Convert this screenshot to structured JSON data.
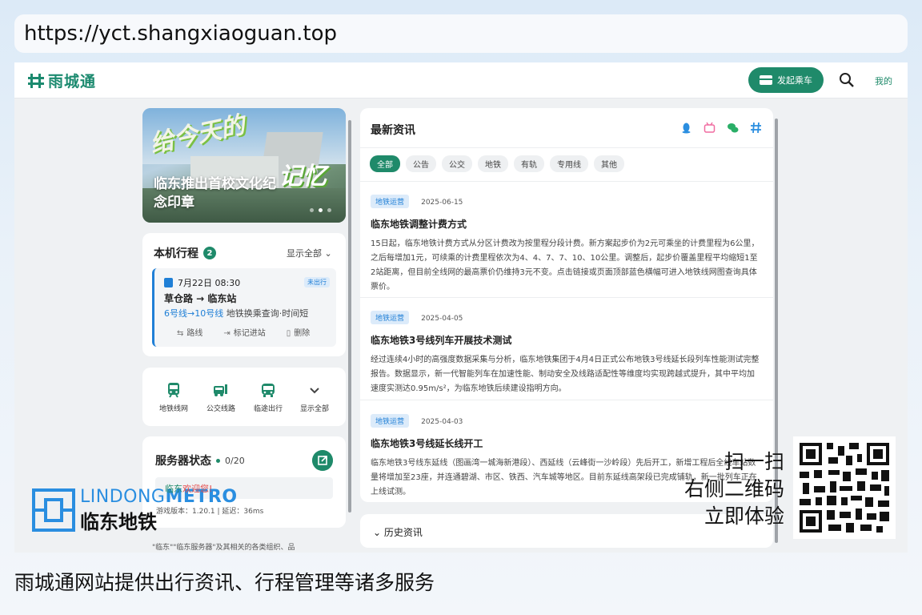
{
  "url": "https://yct.shangxiaoguan.top",
  "nav": {
    "brand": "雨城通",
    "ride_label": "发起乘车",
    "mine_label": "我的"
  },
  "banner": {
    "title": "临东推出首校文化纪念印章",
    "art_line1": "给今天的",
    "art_line2": "记忆"
  },
  "trips": {
    "title": "本机行程",
    "count": "2",
    "show_all": "显示全部 ⌄",
    "item": {
      "date": "7月22日 08:30",
      "status": "未出行",
      "route": "草仓路 → 临东站",
      "lines": "6号线→10号线",
      "desc": "地铁换乘查询·时间短",
      "actions": [
        "路线",
        "标记进站",
        "删除"
      ]
    }
  },
  "quick": [
    {
      "label": "地铁线网",
      "icon": "subway-icon"
    },
    {
      "label": "公交线路",
      "icon": "bus-icon"
    },
    {
      "label": "临途出行",
      "icon": "coach-icon"
    },
    {
      "label": "显示全部",
      "icon": "chevron-down-icon"
    }
  ],
  "server": {
    "title": "服务器状态",
    "count": "0/20",
    "welcome_prefix": "临东",
    "welcome": "欢迎您!",
    "meta": "游戏版本：1.20.1 | 延迟：36ms"
  },
  "footnote": "\"临东\"\"临东服务器\"及其相关的各类组织、品",
  "news": {
    "title": "最新资讯",
    "tabs": [
      "全部",
      "公告",
      "公交",
      "地铁",
      "有轨",
      "专用线",
      "其他"
    ],
    "articles": [
      {
        "tag": "地铁运营",
        "date": "2025-06-15",
        "title": "临东地铁调整计费方式",
        "body": "15日起，临东地铁计费方式从分区计费改为按里程分段计费。新方案起步价为2元可乘坐的计费里程为6公里，之后每增加1元，可续乘的计费里程依次为4、4、7、7、10、10公里。调整后，起步价覆盖里程平均缩短1至2站距离，但目前全线网的最高票价仍维持3元不变。点击链接或页面顶部蓝色横幅可进入地铁线网图查询具体票价。"
      },
      {
        "tag": "地铁运营",
        "date": "2025-04-05",
        "title": "临东地铁3号线列车开展技术测试",
        "body": "经过连续4小时的高强度数据采集与分析，临东地铁集团于4月4日正式公布地铁3号线延长段列车性能测试完整报告。数据显示，新一代智能列车在加速性能、制动安全及线路适配性等维度均实现跨越式提升，其中平均加速度实测达0.95m/s²，为临东地铁后续建设指明方向。"
      },
      {
        "tag": "地铁运营",
        "date": "2025-04-03",
        "title": "临东地铁3号线延长线开工",
        "body": "临东地铁3号线东延线（图画湾一城海新港段）、西延线（云峰街一沙岭段）先后开工，新增工程后全线车站数量将增加至23座，并连通碧湖、市区、铁西、汽车城等地区。目前东延线高架段已完成铺轨，新一批列车正在上线试测。"
      }
    ],
    "history_label": "历史资讯"
  },
  "overlay": {
    "metro_en_1": "LINDONG",
    "metro_en_2": "METRO",
    "metro_cn": "临东地铁",
    "scan_lines": [
      "扫一扫",
      "右侧二维码",
      "立即体验"
    ]
  },
  "caption": "雨城通网站提供出行资讯、行程管理等诸多服务"
}
